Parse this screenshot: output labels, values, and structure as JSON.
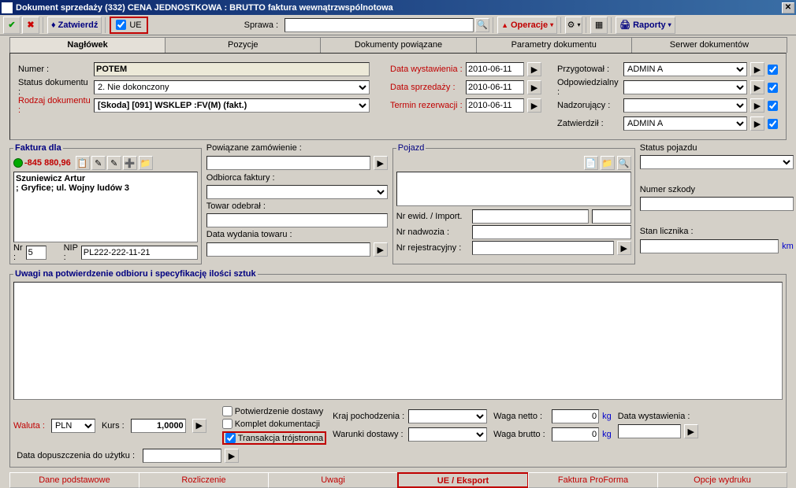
{
  "title": "Dokument sprzedaży (332)     CENA JEDNOSTKOWA : BRUTTO     faktura wewnątrzwspólnotowa",
  "toolbar": {
    "zatwierdz": "Zatwierdź",
    "ue": "UE",
    "sprawa_lbl": "Sprawa :",
    "operacje": "Operacje",
    "raporty": "Raporty"
  },
  "tabs": [
    "Nagłówek",
    "Pozycje",
    "Dokumenty powiązane",
    "Parametry dokumentu",
    "Serwer dokumentów"
  ],
  "header": {
    "numer_lbl": "Numer :",
    "numer": "POTEM",
    "status_lbl": "Status dokumentu :",
    "status": "2. Nie dokonczony",
    "rodzaj_lbl": "Rodzaj dokumentu :",
    "rodzaj": "[Skoda] [091]  WSKLEP :FV(M) (fakt.)",
    "data_wys_lbl": "Data wystawienia :",
    "data_wys": "2010-06-11",
    "data_sprz_lbl": "Data sprzedaży :",
    "data_sprz": "2010-06-11",
    "termin_lbl": "Termin rezerwacji :",
    "termin": "2010-06-11",
    "przyg_lbl": "Przygotował :",
    "przyg": "ADMIN A",
    "odp_lbl": "Odpowiedzialny :",
    "odp": "",
    "nadz_lbl": "Nadzorujący :",
    "nadz": "",
    "zatw_lbl": "Zatwierdził :",
    "zatw": "ADMIN A"
  },
  "faktura": {
    "legend": "Faktura dla",
    "amount": "-845 880,96",
    "name": "Szuniewicz Artur",
    "addr": "; Gryfice; ul. Wojny ludów  3",
    "nr_lbl": "Nr :",
    "nr": "5",
    "nip_lbl": "NIP :",
    "nip": "PL222-222-11-21"
  },
  "powiaz": {
    "zam_lbl": "Powiązane zamówienie :",
    "odb_lbl": "Odbiorca faktury :",
    "towar_lbl": "Towar odebrał :",
    "data_wyd_lbl": "Data wydania towaru :"
  },
  "pojazd": {
    "legend": "Pojazd",
    "nr_ewid_lbl": "Nr ewid. / Import.",
    "nr_nadw_lbl": "Nr nadwozia :",
    "nr_rej_lbl": "Nr rejestracyjny :",
    "status_lbl": "Status pojazdu",
    "szkoda_lbl": "Numer szkody",
    "licznik_lbl": "Stan licznika :",
    "km": "km"
  },
  "uwagi_legend": "Uwagi na potwierdzenie odbioru i specyfikację ilości sztuk",
  "bottom": {
    "waluta_lbl": "Waluta :",
    "waluta": "PLN",
    "kurs_lbl": "Kurs :",
    "kurs": "1,0000",
    "data_dop_lbl": "Data dopuszczenia do użytku :",
    "potw": "Potwierdzenie dostawy",
    "komplet": "Komplet dokumentacji",
    "trans": "Transakcja trójstronna",
    "kraj_lbl": "Kraj pochodzenia :",
    "warunki_lbl": "Warunki dostawy :",
    "waga_n_lbl": "Waga netto :",
    "waga_n": "0",
    "kg": "kg",
    "waga_b_lbl": "Waga brutto :",
    "waga_b": "0",
    "data_wys_lbl": "Data wystawienia :"
  },
  "bottabs": [
    "Dane podstawowe",
    "Rozliczenie",
    "Uwagi",
    "UE / Eksport",
    "Faktura ProForma",
    "Opcje wydruku"
  ]
}
